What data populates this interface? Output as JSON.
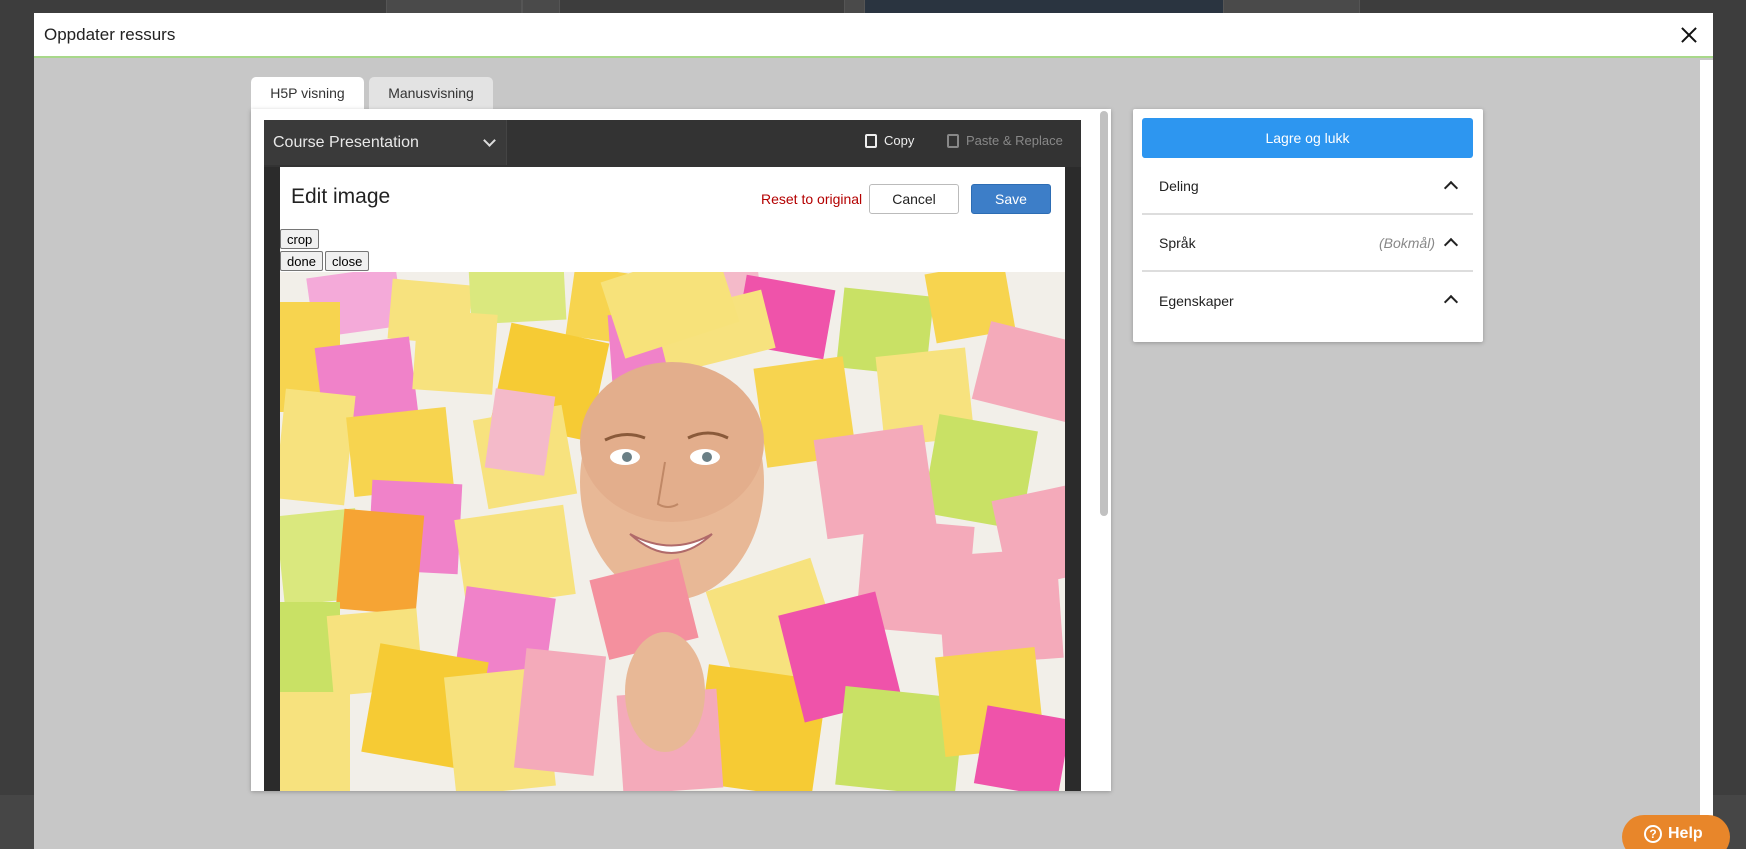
{
  "dialog": {
    "title": "Oppdater ressurs",
    "close_icon": "close-icon"
  },
  "tabs": [
    {
      "label": "H5P visning",
      "active": true
    },
    {
      "label": "Manusvisning",
      "active": false
    }
  ],
  "editor": {
    "content_type": "Course Presentation",
    "copy_label": "Copy",
    "paste_label": "Paste & Replace"
  },
  "edit_image": {
    "title": "Edit image",
    "reset_label": "Reset to original",
    "cancel_label": "Cancel",
    "save_label": "Save",
    "crop_label": "crop",
    "done_label": "done",
    "close_label": "close"
  },
  "sidebar": {
    "save_close_label": "Lagre og lukk",
    "sections": [
      {
        "label": "Deling",
        "value": ""
      },
      {
        "label": "Språk",
        "value": "(Bokmål)"
      },
      {
        "label": "Egenskaper",
        "value": ""
      }
    ]
  },
  "help": {
    "label": "Help"
  },
  "colors": {
    "primary": "#2d96f0",
    "save": "#3d7ec8",
    "reset": "#b40000",
    "help": "#e8862a",
    "header_accent": "#a8d88a"
  }
}
